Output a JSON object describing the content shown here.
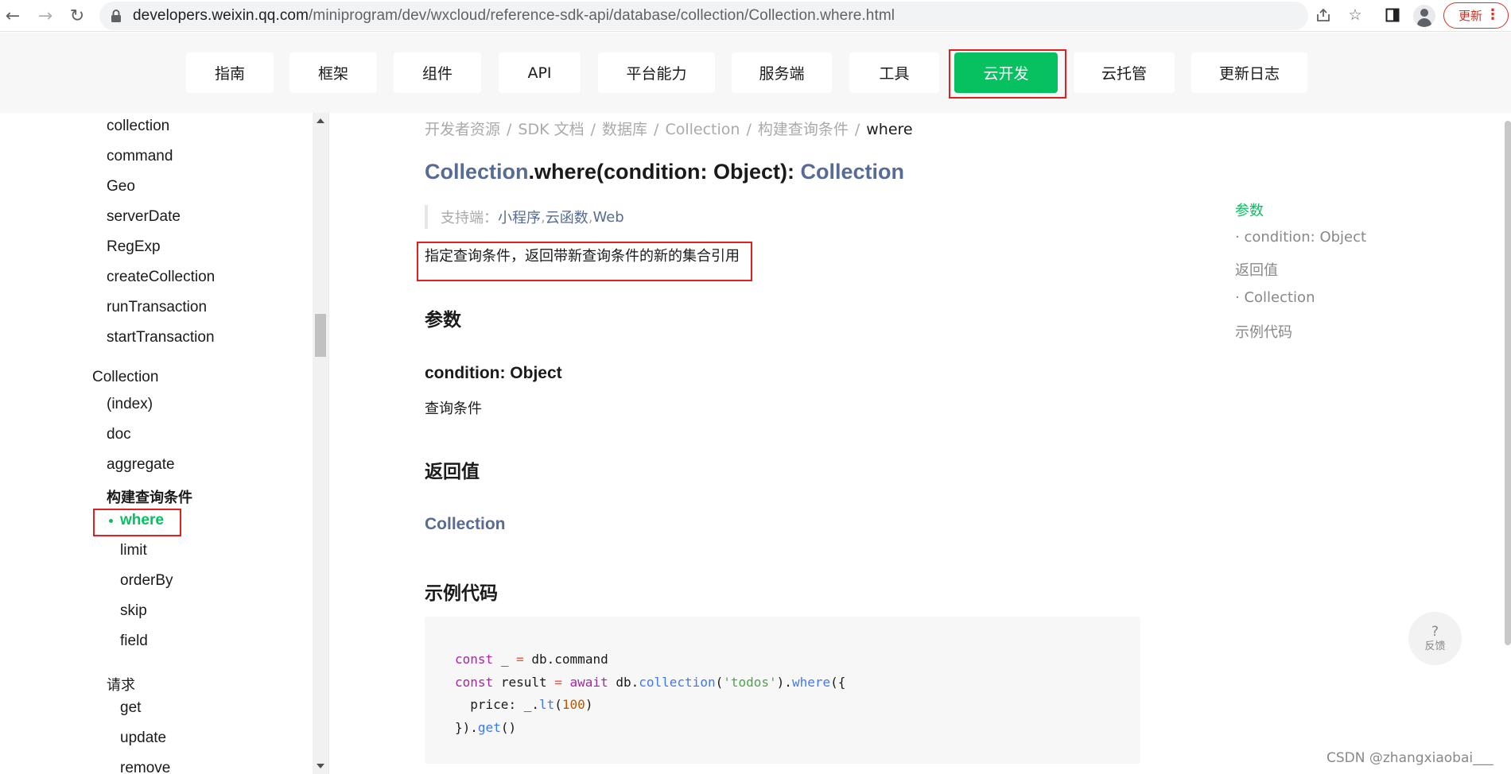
{
  "browser": {
    "url_host": "developers.weixin.qq.com",
    "url_path": "/miniprogram/dev/wxcloud/reference-sdk-api/database/collection/Collection.where.html",
    "update_label": "更新"
  },
  "top_nav": {
    "tabs": [
      {
        "label": "指南"
      },
      {
        "label": "框架"
      },
      {
        "label": "组件"
      },
      {
        "label": "API"
      },
      {
        "label": "平台能力"
      },
      {
        "label": "服务端"
      },
      {
        "label": "工具"
      },
      {
        "label": "云开发",
        "active": true
      },
      {
        "label": "云托管"
      },
      {
        "label": "更新日志"
      }
    ]
  },
  "sidebar": {
    "items": [
      "collection",
      "command",
      "Geo",
      "serverDate",
      "RegExp",
      "createCollection",
      "runTransaction",
      "startTransaction",
      "Collection",
      "(index)",
      "doc",
      "aggregate",
      "构建查询条件",
      "where",
      "limit",
      "orderBy",
      "skip",
      "field",
      "请求",
      "get",
      "update",
      "remove"
    ]
  },
  "breadcrumb": {
    "items": [
      "开发者资源",
      "SDK 文档",
      "数据库",
      "Collection",
      "构建查询条件"
    ],
    "separator": "/",
    "current": "where"
  },
  "title": {
    "class_name": "Collection",
    "method": ".where(condition: Object): ",
    "return_type": "Collection"
  },
  "support": {
    "label": "支持端：",
    "platforms": [
      "小程序",
      "云函数",
      "Web"
    ],
    "separator": ", "
  },
  "description": "指定查询条件，返回带新查询条件的新的集合引用",
  "sections": {
    "params_heading": "参数",
    "param_name": "condition: Object",
    "param_desc": "查询条件",
    "return_heading": "返回值",
    "return_type": "Collection",
    "example_heading": "示例代码"
  },
  "code": {
    "lines": [
      "const _ = db.command",
      "const result = await db.collection('todos').where({",
      "  price: _.lt(100)",
      "}).get()"
    ]
  },
  "toc": {
    "items": [
      {
        "label": "参数",
        "active": true
      },
      {
        "label": "· condition: Object"
      },
      {
        "label": "返回值"
      },
      {
        "label": "· Collection"
      },
      {
        "label": "示例代码"
      }
    ]
  },
  "feedback": {
    "icon": "?",
    "label": "反馈"
  },
  "watermark": "CSDN @zhangxiaobai___",
  "colors": {
    "accent_green": "#07c160",
    "link_blue": "#576b95",
    "highlight_red": "#e02020"
  }
}
